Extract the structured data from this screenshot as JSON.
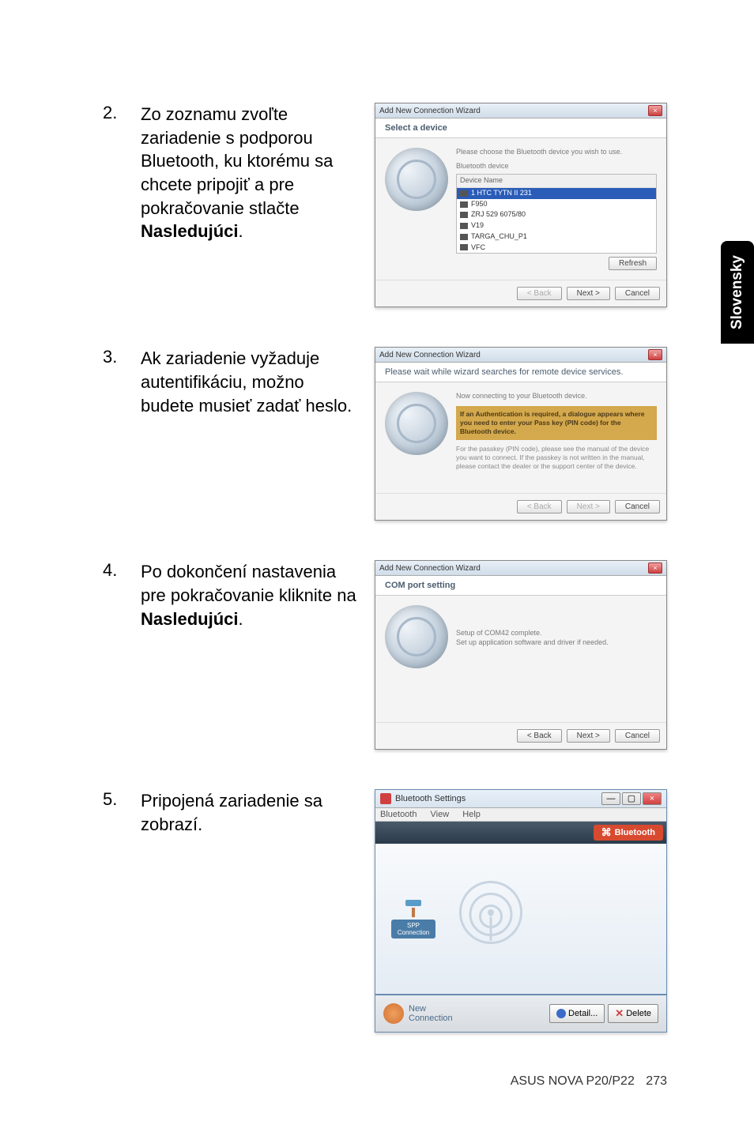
{
  "sideTab": "Slovensky",
  "steps": [
    {
      "num": "2.",
      "text": "Zo zoznamu zvoľte zariadenie s podporou Bluetooth, ku ktorému sa chcete pripojiť a pre pokračovanie stlačte ",
      "bold": "Nasledujúci",
      "after": "."
    },
    {
      "num": "3.",
      "text": "Ak zariadenie vyžaduje autentifikáciu, možno budete musieť zadať heslo.",
      "bold": "",
      "after": ""
    },
    {
      "num": "4.",
      "text": "Po dokončení nastavenia pre pokračovanie kliknite na ",
      "bold": "Nasledujúci",
      "after": "."
    },
    {
      "num": "5.",
      "text": "Pripojená zariadenie sa zobrazí.",
      "bold": "",
      "after": ""
    }
  ],
  "dialog1": {
    "title": "Add New Connection Wizard",
    "header": "Select a device",
    "instruction": "Please choose the Bluetooth device you wish to use.",
    "listLabel": "Bluetooth device",
    "col": "Device Name",
    "devices": [
      "1 HTC TYTN II 231",
      "F950",
      "ZRJ 529 6075/80",
      "V19",
      "TARGA_CHU_P1",
      "VFC"
    ],
    "refresh": "Refresh",
    "back": "< Back",
    "next": "Next >",
    "cancel": "Cancel"
  },
  "dialog2": {
    "title": "Add New Connection Wizard",
    "header": "Please wait while wizard searches for remote device services.",
    "connecting": "Now connecting to your Bluetooth device.",
    "yellowBold": "If an Authentication is required, a dialogue appears where you need to enter your Pass key (PIN code) for the Bluetooth device.",
    "grayText": "For the passkey (PIN code), please see the manual of the device you want to connect. If the passkey is not written in the manual, please contact the dealer or the support center of the device.",
    "back": "< Back",
    "next": "Next >",
    "cancel": "Cancel"
  },
  "dialog3": {
    "title": "Add New Connection Wizard",
    "header": "COM port setting",
    "line1": "Setup of COM42 complete.",
    "line2": "Set up application software and driver if needed.",
    "back": "< Back",
    "next": "Next >",
    "cancel": "Cancel"
  },
  "settings": {
    "title": "Bluetooth Settings",
    "menu": [
      "Bluetooth",
      "View",
      "Help"
    ],
    "badge": "Bluetooth",
    "connLabel1": "SPP",
    "connLabel2": "Connection",
    "newConn": "New\nConnection",
    "detail": "Detail...",
    "delete": "Delete"
  },
  "footer": {
    "text": "ASUS NOVA P20/P22",
    "page": "273"
  }
}
